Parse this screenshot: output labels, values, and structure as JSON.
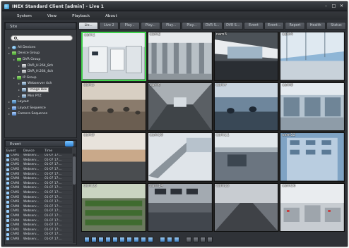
{
  "window": {
    "title": "INEX Standard Client [admin] - Live 1",
    "controls": [
      "–",
      "□",
      "✕"
    ]
  },
  "menu": [
    "System",
    "View",
    "Playback",
    "About"
  ],
  "site": {
    "header": "Site",
    "search_placeholder": "",
    "tree": [
      {
        "label": "All Devices",
        "icon": "world-icon",
        "indent": 0
      },
      {
        "label": "Device Group",
        "icon": "group-icon",
        "indent": 0
      },
      {
        "label": "DVR Group",
        "icon": "group-icon",
        "indent": 1
      },
      {
        "label": "DVR_H.264_8ch",
        "icon": "dvr-icon",
        "indent": 2
      },
      {
        "label": "DVR_H.264_4ch",
        "icon": "dvr-icon",
        "indent": 2
      },
      {
        "label": "IP Group",
        "icon": "group-icon",
        "indent": 1
      },
      {
        "label": "Webserver 4ch",
        "icon": "camera-icon",
        "indent": 2
      },
      {
        "label": "Image Box",
        "icon": "camera-icon",
        "indent": 2,
        "selected": true
      },
      {
        "label": "Mini PTZ",
        "icon": "camera-icon",
        "indent": 2
      },
      {
        "label": "Layout",
        "icon": "layout-icon",
        "indent": 0
      },
      {
        "label": "Layout Sequence",
        "icon": "sequence-icon",
        "indent": 0
      },
      {
        "label": "Camera Sequence",
        "icon": "sequence-icon",
        "indent": 0
      }
    ]
  },
  "event": {
    "header": "Event",
    "columns": [
      "Event",
      "Device",
      "Time"
    ],
    "rows": [
      [
        "CAM1",
        "Webserv...",
        "01-07 17:..."
      ],
      [
        "CAM1",
        "Webserv...",
        "01-07 17:..."
      ],
      [
        "CAM1",
        "Webserv...",
        "01-07 17:..."
      ],
      [
        "CAM2",
        "Webserv...",
        "01-07 17:..."
      ],
      [
        "CAM3",
        "Webserv...",
        "01-07 17:..."
      ],
      [
        "CAM4",
        "Webserv...",
        "01-07 17:..."
      ],
      [
        "CAM4",
        "Webserv...",
        "01-07 17:..."
      ],
      [
        "CAM4",
        "Webserv...",
        "01-07 17:..."
      ],
      [
        "CAM1",
        "Webserv...",
        "01-07 17:..."
      ],
      [
        "CAM2",
        "Webserv...",
        "01-07 17:..."
      ],
      [
        "CAM3",
        "Webserv...",
        "01-07 17:..."
      ],
      [
        "CAM4",
        "Webserv...",
        "01-07 17:..."
      ],
      [
        "CAM1",
        "Webserv...",
        "01-07 17:..."
      ],
      [
        "CAM4",
        "Webserv...",
        "01-07 17:..."
      ],
      [
        "CAM4",
        "Webserv...",
        "01-07 17:..."
      ],
      [
        "CAM4",
        "Webserv...",
        "01-07 17:..."
      ],
      [
        "CAM1",
        "Webserv...",
        "01-07 17:..."
      ],
      [
        "CAM2",
        "Webserv...",
        "01-07 17:..."
      ],
      [
        "CAM3",
        "Webserv...",
        "01-07 17:..."
      ]
    ]
  },
  "tabs": [
    "Liv...",
    "Live 2",
    "Play...",
    "Play...",
    "Play...",
    "Play...",
    "DVR S...",
    "DVR S...",
    "Event",
    "Event...",
    "Report",
    "Health",
    "Status"
  ],
  "cameras": [
    {
      "label": "cam1",
      "scene": "server-room",
      "active": true
    },
    {
      "label": "cam2",
      "scene": "warehouse"
    },
    {
      "label": "cam3",
      "scene": "lobby"
    },
    {
      "label": "cam4",
      "scene": "airport"
    },
    {
      "label": "cam5",
      "scene": "cafeteria"
    },
    {
      "label": "cam6",
      "scene": "hall"
    },
    {
      "label": "cam7",
      "scene": "shop"
    },
    {
      "label": "cam8",
      "scene": "store"
    },
    {
      "label": "cam9",
      "scene": "mall"
    },
    {
      "label": "cam10",
      "scene": "escalator"
    },
    {
      "label": "cam11",
      "scene": "office"
    },
    {
      "label": "cam12",
      "scene": "building"
    },
    {
      "label": "cam13",
      "scene": "greenhouse"
    },
    {
      "label": "cam14",
      "scene": "control-room"
    },
    {
      "label": "cam15",
      "scene": "street"
    },
    {
      "label": "cam16",
      "scene": "factory"
    }
  ],
  "toolbar": {
    "buttons": [
      "layout-1x1",
      "layout-2x2",
      "layout-3x3",
      "layout-4x4",
      "layout-5x5",
      "layout-6x6",
      "layout-custom-1",
      "layout-custom-2",
      "layout-custom-3",
      "layout-custom-4",
      "fullscreen",
      "prev-page",
      "next-page",
      "snapshot",
      "record",
      "settings",
      "export"
    ]
  },
  "colors": {
    "active_border": "#3fd14b",
    "window_bg": "#2f3237"
  }
}
